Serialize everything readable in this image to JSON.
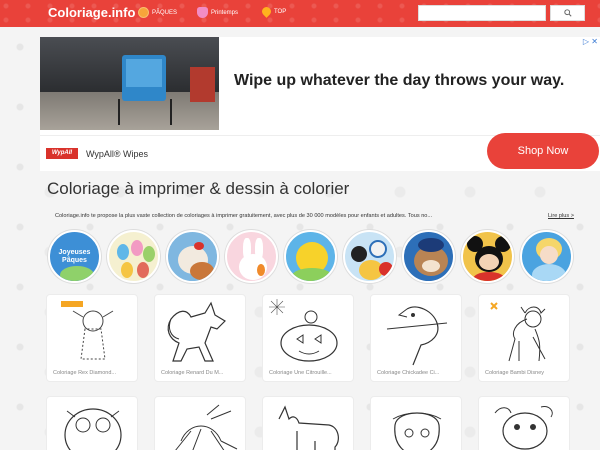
{
  "header": {
    "logo": "Coloriage.info",
    "nav": [
      {
        "label": "PÂQUES",
        "icon": "egg-icon"
      },
      {
        "label": "Printemps",
        "icon": "flower-icon"
      },
      {
        "label": "TOP",
        "icon": "fire-icon"
      }
    ],
    "search_placeholder": "",
    "search_icon": "search-icon"
  },
  "ad": {
    "headline": "Wipe up whatever the day throws your way.",
    "brand_logo": "WypAll",
    "brand": "WypAll® Wipes",
    "cta": "Shop Now",
    "close_label": "▷ ✕"
  },
  "main": {
    "title": "Coloriage à imprimer & dessin à colorier",
    "intro": "Coloriage.info te propose la plus vaste collection de coloriages à imprimer gratuitement, avec plus de 30 000 modèles pour enfants et adultes. Tous no...",
    "read_more": "Lire plus >"
  },
  "categories": [
    {
      "label": "Joyeuses Pâques",
      "color": "#3d8fd6"
    },
    {
      "label": "",
      "color": "#f5f0d0"
    },
    {
      "label": "",
      "color": "#7fb7e0"
    },
    {
      "label": "",
      "color": "#f9d6df"
    },
    {
      "label": "",
      "color": "#5db4e8"
    },
    {
      "label": "",
      "color": "#c8e3f5"
    },
    {
      "label": "",
      "color": "#2d6fb8"
    },
    {
      "label": "",
      "color": "#f1c34a"
    },
    {
      "label": "",
      "color": "#4aa3e0"
    }
  ],
  "cards": [
    {
      "label": "Coloriage Rex Diamond..."
    },
    {
      "label": "Coloriage Renard Du M..."
    },
    {
      "label": "Coloriage Une Citrouille..."
    },
    {
      "label": "Coloriage Chickadee Ci..."
    },
    {
      "label": "Coloriage Bambi Disney"
    },
    {
      "label": ""
    },
    {
      "label": ""
    },
    {
      "label": ""
    },
    {
      "label": ""
    },
    {
      "label": ""
    }
  ]
}
